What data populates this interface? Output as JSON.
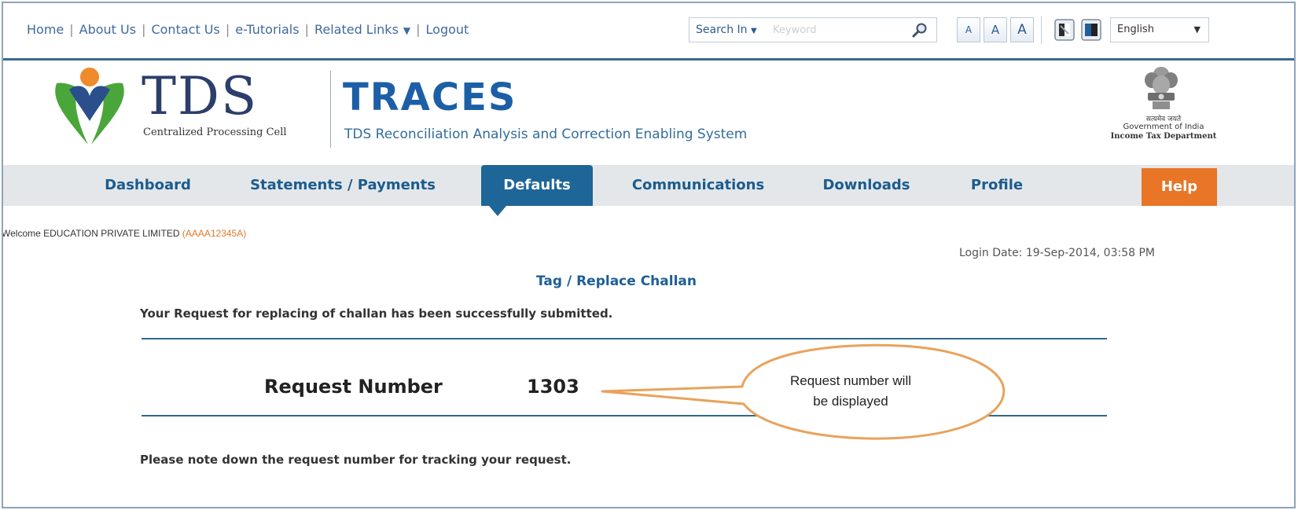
{
  "topbar": {
    "links": [
      {
        "label": "Home"
      },
      {
        "label": "About Us"
      },
      {
        "label": "Contact Us"
      },
      {
        "label": "e-Tutorials"
      },
      {
        "label": "Related Links"
      },
      {
        "label": "Logout"
      }
    ],
    "search": {
      "scope_label": "Search In",
      "placeholder": "Keyword"
    },
    "font_sizes": [
      "A",
      "A",
      "A"
    ],
    "language": "English"
  },
  "branding": {
    "logo_text": "TDS",
    "logo_subtitle": "Centralized Processing Cell",
    "app_name": "TRACES",
    "app_subtitle": "TDS Reconciliation Analysis and Correction Enabling System",
    "gov_hindi": "सत्यमेव जयते",
    "gov_name": "Government of India",
    "department": "Income Tax Department"
  },
  "nav": {
    "items": [
      {
        "label": "Dashboard"
      },
      {
        "label": "Statements / Payments"
      },
      {
        "label": "Defaults"
      },
      {
        "label": "Communications"
      },
      {
        "label": "Downloads"
      },
      {
        "label": "Profile"
      },
      {
        "label": "Help"
      }
    ],
    "active": "Defaults"
  },
  "user": {
    "welcome_prefix": "Welcome",
    "name": "EDUCATION PRIVATE LIMITED",
    "pan": "(AAAA12345A)",
    "login_date": "Login Date: 19-Sep-2014, 03:58 PM"
  },
  "main": {
    "title": "Tag / Replace Challan",
    "success_message": "Your Request for replacing of challan has been successfully submitted.",
    "request_label": "Request Number",
    "request_number": "1303",
    "note": "Please note down the request number for tracking your request."
  },
  "callout": {
    "line1": "Request number will",
    "line2": "be displayed"
  },
  "colors": {
    "nav_active": "#1e6697",
    "help": "#e97526",
    "link": "#3f6aa0",
    "callout_stroke": "#e8a35c"
  }
}
